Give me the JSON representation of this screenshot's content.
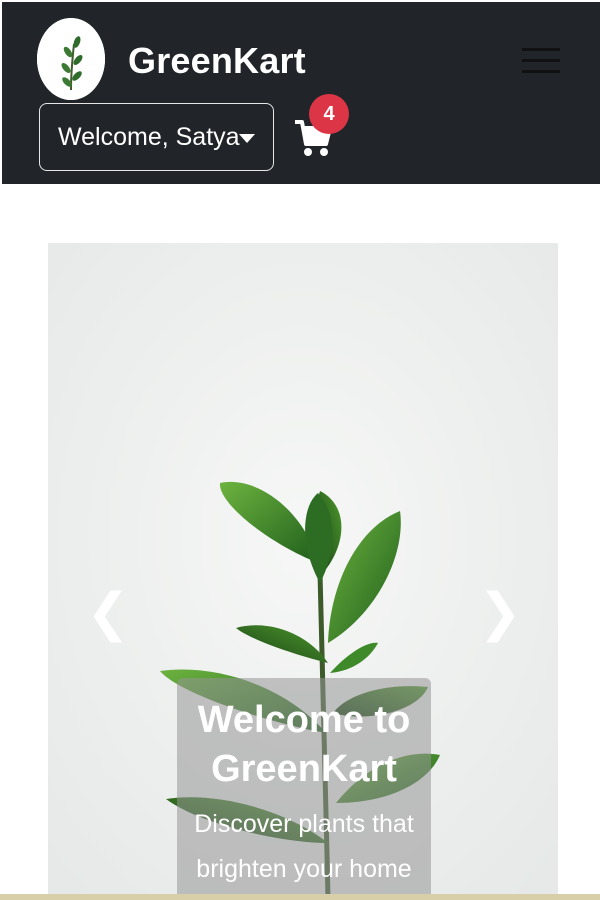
{
  "navbar": {
    "brand": "GreenKart",
    "user_menu_label": "Welcome, Satya",
    "cart_count": "4",
    "logo_icon": "plant-logo-icon",
    "menu_icon": "hamburger-icon",
    "cart_icon": "shopping-cart-icon",
    "colors": {
      "background": "#212529",
      "badge": "#dc3545"
    }
  },
  "carousel": {
    "title": "Welcome to GreenKart",
    "subtitle": "Discover plants that brighten your home",
    "prev_icon": "chevron-left-icon",
    "next_icon": "chevron-right-icon",
    "prev_glyph": "❮",
    "next_glyph": "❯"
  }
}
